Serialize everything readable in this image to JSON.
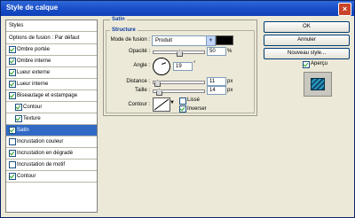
{
  "window": {
    "title": "Style de calque"
  },
  "sidebar": {
    "header": "Styles",
    "blend_options": "Options de fusion : Par défaut",
    "items": [
      {
        "label": "Ombre portée",
        "checked": true
      },
      {
        "label": "Ombre interne",
        "checked": true
      },
      {
        "label": "Lueur externe",
        "checked": true
      },
      {
        "label": "Lueur interne",
        "checked": true
      },
      {
        "label": "Biseautage et estampage",
        "checked": true
      },
      {
        "label": "Contour",
        "checked": true
      },
      {
        "label": "Texture",
        "checked": true
      },
      {
        "label": "Satin",
        "checked": true,
        "selected": true
      },
      {
        "label": "Incrustation couleur",
        "checked": false
      },
      {
        "label": "Incrustation en dégradé",
        "checked": true
      },
      {
        "label": "Incrustation de motif",
        "checked": false
      },
      {
        "label": "Contour",
        "checked": true
      }
    ]
  },
  "satin": {
    "group_title": "Satin",
    "structure_title": "Structure",
    "blend_mode_label": "Mode de fusion :",
    "blend_mode_value": "Produit",
    "opacity_label": "Opacité :",
    "opacity_value": "50",
    "opacity_unit": "%",
    "opacity_fraction": 0.5,
    "angle_label": "Angle :",
    "angle_value": "19",
    "angle_unit": "°",
    "distance_label": "Distance :",
    "distance_value": "11",
    "distance_unit": "px",
    "size_label": "Taille :",
    "size_value": "14",
    "size_unit": "px",
    "contour_label": "Contour :",
    "smooth_label": "Lissé",
    "smooth_checked": false,
    "invert_label": "Inverser",
    "invert_checked": true,
    "color": "#000000"
  },
  "buttons": {
    "ok": "OK",
    "cancel": "Annuler",
    "new_style": "Nouveau style...",
    "preview_label": "Aperçu",
    "preview_checked": true
  }
}
